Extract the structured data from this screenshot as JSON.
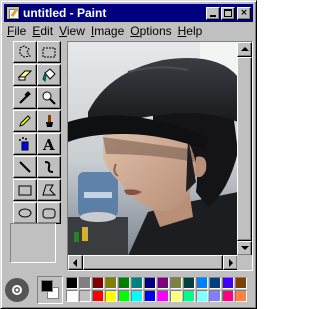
{
  "window": {
    "title": "untitled - Paint",
    "controls": {
      "minimize": "minimize",
      "maximize": "maximize",
      "close": "×"
    }
  },
  "menu": {
    "items": [
      {
        "label": "File",
        "underline": "F",
        "rest": "ile"
      },
      {
        "label": "Edit",
        "underline": "E",
        "rest": "dit"
      },
      {
        "label": "View",
        "underline": "V",
        "rest": "iew"
      },
      {
        "label": "Image",
        "underline": "I",
        "rest": "mage"
      },
      {
        "label": "Options",
        "underline": "O",
        "rest": "ptions"
      },
      {
        "label": "Help",
        "underline": "H",
        "rest": "elp"
      }
    ]
  },
  "tools": [
    {
      "name": "free-form-select-icon"
    },
    {
      "name": "rect-select-icon"
    },
    {
      "name": "eraser-icon"
    },
    {
      "name": "fill-bucket-icon"
    },
    {
      "name": "eyedropper-icon"
    },
    {
      "name": "magnifier-icon"
    },
    {
      "name": "pencil-icon"
    },
    {
      "name": "brush-icon"
    },
    {
      "name": "airbrush-icon"
    },
    {
      "name": "text-icon",
      "glyph": "A"
    },
    {
      "name": "line-icon"
    },
    {
      "name": "curve-icon"
    },
    {
      "name": "rectangle-icon"
    },
    {
      "name": "polygon-icon"
    },
    {
      "name": "ellipse-icon"
    },
    {
      "name": "rounded-rect-icon"
    }
  ],
  "colors": {
    "foreground": "#000000",
    "background": "#ffffff",
    "palette_top": [
      "#000000",
      "#808080",
      "#800000",
      "#808000",
      "#008000",
      "#008080",
      "#000080",
      "#800080",
      "#808040",
      "#004040",
      "#0080ff",
      "#004080",
      "#4000ff",
      "#804000"
    ],
    "palette_bottom": [
      "#ffffff",
      "#c0c0c0",
      "#ff0000",
      "#ffff00",
      "#00ff00",
      "#00ffff",
      "#0000ff",
      "#ff00ff",
      "#ffff80",
      "#00ff80",
      "#80ffff",
      "#8080ff",
      "#ff0080",
      "#ff8040"
    ]
  },
  "canvas": {
    "content": "photo"
  }
}
